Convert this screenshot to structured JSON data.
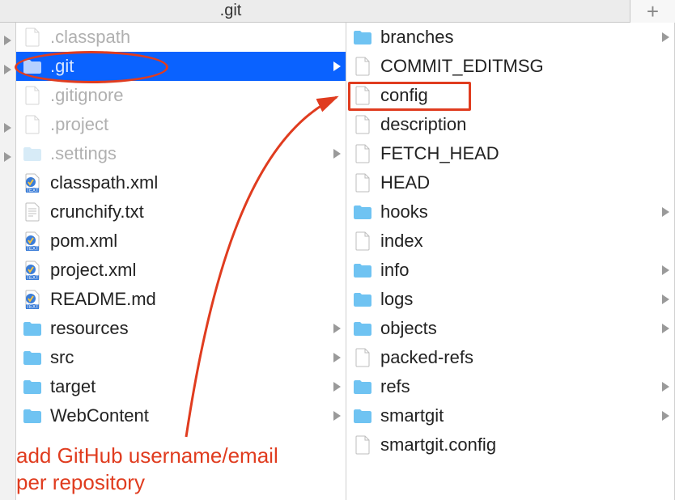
{
  "titlebar": {
    "title": ".git",
    "add_tab_glyph": "+"
  },
  "col0_arrows": [
    true,
    true,
    false,
    true,
    true,
    false,
    false,
    false,
    false,
    false,
    false,
    false,
    false,
    false
  ],
  "left_items": [
    {
      "name": ".classpath",
      "icon": "file",
      "dim": true,
      "selected": false,
      "expand": false
    },
    {
      "name": ".git",
      "icon": "folder",
      "dim": true,
      "selected": true,
      "expand": true
    },
    {
      "name": ".gitignore",
      "icon": "file",
      "dim": true,
      "selected": false,
      "expand": false
    },
    {
      "name": ".project",
      "icon": "file",
      "dim": true,
      "selected": false,
      "expand": false
    },
    {
      "name": ".settings",
      "icon": "folder",
      "dim": true,
      "selected": false,
      "expand": true
    },
    {
      "name": "classpath.xml",
      "icon": "xml",
      "dim": false,
      "selected": false,
      "expand": false
    },
    {
      "name": "crunchify.txt",
      "icon": "txt",
      "dim": false,
      "selected": false,
      "expand": false
    },
    {
      "name": "pom.xml",
      "icon": "xml",
      "dim": false,
      "selected": false,
      "expand": false
    },
    {
      "name": "project.xml",
      "icon": "xml",
      "dim": false,
      "selected": false,
      "expand": false
    },
    {
      "name": "README.md",
      "icon": "xml",
      "dim": false,
      "selected": false,
      "expand": false
    },
    {
      "name": "resources",
      "icon": "folder",
      "dim": false,
      "selected": false,
      "expand": true
    },
    {
      "name": "src",
      "icon": "folder",
      "dim": false,
      "selected": false,
      "expand": true
    },
    {
      "name": "target",
      "icon": "folder",
      "dim": false,
      "selected": false,
      "expand": true
    },
    {
      "name": "WebContent",
      "icon": "folder",
      "dim": false,
      "selected": false,
      "expand": true
    }
  ],
  "right_items": [
    {
      "name": "branches",
      "icon": "folder",
      "expand": true
    },
    {
      "name": "COMMIT_EDITMSG",
      "icon": "file",
      "expand": false
    },
    {
      "name": "config",
      "icon": "file",
      "expand": false,
      "highlight": true
    },
    {
      "name": "description",
      "icon": "file",
      "expand": false
    },
    {
      "name": "FETCH_HEAD",
      "icon": "file",
      "expand": false
    },
    {
      "name": "HEAD",
      "icon": "file",
      "expand": false
    },
    {
      "name": "hooks",
      "icon": "folder",
      "expand": true
    },
    {
      "name": "index",
      "icon": "file",
      "expand": false
    },
    {
      "name": "info",
      "icon": "folder",
      "expand": true
    },
    {
      "name": "logs",
      "icon": "folder",
      "expand": true
    },
    {
      "name": "objects",
      "icon": "folder",
      "expand": true
    },
    {
      "name": "packed-refs",
      "icon": "file",
      "expand": false
    },
    {
      "name": "refs",
      "icon": "folder",
      "expand": true
    },
    {
      "name": "smartgit",
      "icon": "folder",
      "expand": true
    },
    {
      "name": "smartgit.config",
      "icon": "file",
      "expand": false
    }
  ],
  "annotation": {
    "text_line1": "add GitHub username/email",
    "text_line2": "per repository",
    "ellipse_around": ".git",
    "box_around": "config"
  },
  "colors": {
    "accent": "#0a62ff",
    "annotation": "#e03c1f",
    "folder": "#6fc3f2"
  }
}
